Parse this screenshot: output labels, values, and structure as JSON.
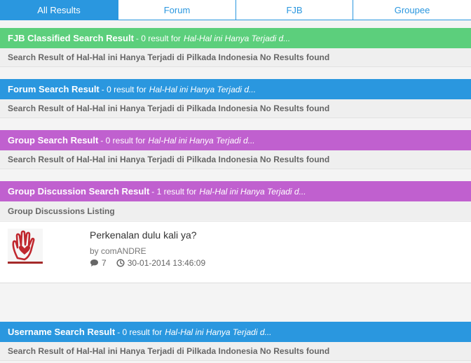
{
  "tabs": [
    {
      "label": "All Results",
      "active": true
    },
    {
      "label": "Forum",
      "active": false
    },
    {
      "label": "FJB",
      "active": false
    },
    {
      "label": "Groupee",
      "active": false
    }
  ],
  "colors": {
    "blue": "#2a97df",
    "green": "#5ccf7c",
    "purple": "#c060cf"
  },
  "sections": {
    "fjb": {
      "title": "FJB Classified Search Result",
      "count": "- 0 result for",
      "query": "Hal-Hal ini Hanya Terjadi d...",
      "body": "Search Result of Hal-Hal ini Hanya Terjadi di Pilkada Indonesia No Results found"
    },
    "forum": {
      "title": "Forum Search Result",
      "count": "- 0 result for",
      "query": "Hal-Hal ini Hanya Terjadi d...",
      "body": "Search Result of Hal-Hal ini Hanya Terjadi di Pilkada Indonesia No Results found"
    },
    "group": {
      "title": "Group Search Result",
      "count": "- 0 result for",
      "query": "Hal-Hal ini Hanya Terjadi d...",
      "body": "Search Result of Hal-Hal ini Hanya Terjadi di Pilkada Indonesia No Results found"
    },
    "group_discussion": {
      "title": "Group Discussion Search Result",
      "count": "- 1 result for",
      "query": "Hal-Hal ini Hanya Terjadi d...",
      "listing_label": "Group Discussions Listing",
      "item": {
        "thumbnail_icon": "heart-hand-icon",
        "title": "Perkenalan dulu kali ya?",
        "author": "by comANDRE",
        "replies": "7",
        "timestamp": "30-01-2014 13:46:09"
      }
    },
    "username": {
      "title": "Username Search Result",
      "count": "- 0 result for",
      "query": "Hal-Hal ini Hanya Terjadi d...",
      "body": "Search Result of Hal-Hal ini Hanya Terjadi di Pilkada Indonesia No Results found"
    }
  }
}
